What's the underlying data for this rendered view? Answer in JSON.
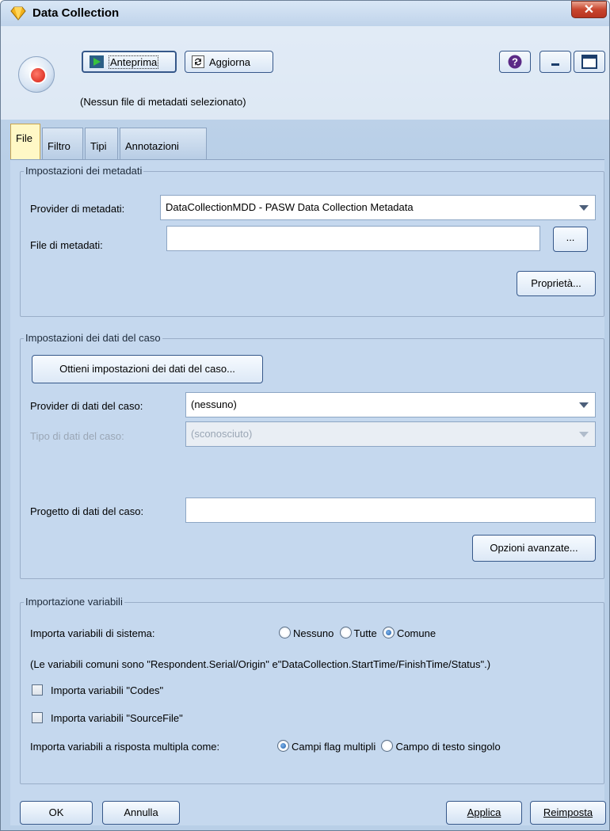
{
  "window": {
    "title": "Data Collection",
    "close_label": "✕"
  },
  "toolbar": {
    "preview_label": "Anteprima",
    "refresh_label": "Aggiorna",
    "status": "(Nessun file di metadati selezionato)"
  },
  "tabs": [
    {
      "label": "File",
      "active": true
    },
    {
      "label": "Filtro",
      "active": false
    },
    {
      "label": "Tipi",
      "active": false
    },
    {
      "label": "Annotazioni",
      "active": false
    }
  ],
  "metadata_settings": {
    "legend": "Impostazioni dei metadati",
    "provider_label": "Provider di metadati:",
    "provider_value": "DataCollectionMDD - PASW Data Collection Metadata",
    "file_label": "File di metadati:",
    "file_value": "",
    "browse_label": "...",
    "properties_label": "Proprietà..."
  },
  "case_data_settings": {
    "legend": "Impostazioni dei dati del caso",
    "get_settings_label": "Ottieni impostazioni dei dati del caso...",
    "provider_label": "Provider di dati del caso:",
    "provider_value": "(nessuno)",
    "type_label": "Tipo di dati del caso:",
    "type_value": "(sconosciuto)",
    "project_label": "Progetto di dati del caso:",
    "project_value": "",
    "advanced_label": "Opzioni avanzate..."
  },
  "variable_import": {
    "legend": "Importazione variabili",
    "system_vars_label": "Importa variabili di sistema:",
    "system_options": [
      {
        "label": "Nessuno",
        "selected": false
      },
      {
        "label": "Tutte",
        "selected": false
      },
      {
        "label": "Comune",
        "selected": true
      }
    ],
    "common_note": "(Le variabili comuni sono \"Respondent.Serial/Origin\" e\"DataCollection.StartTime/FinishTime/Status\".)",
    "codes_label": "Importa variabili \"Codes\"",
    "codes_checked": false,
    "sourcefile_label": "Importa variabili \"SourceFile\"",
    "sourcefile_checked": false,
    "multi_label": "Importa variabili a risposta multipla come:",
    "multi_options": [
      {
        "label": "Campi flag multipli",
        "selected": true
      },
      {
        "label": "Campo di testo singolo",
        "selected": false
      }
    ]
  },
  "footer": {
    "ok_label": "OK",
    "cancel_label": "Annulla",
    "apply_label": "Applica",
    "reset_label": "Reimposta"
  }
}
